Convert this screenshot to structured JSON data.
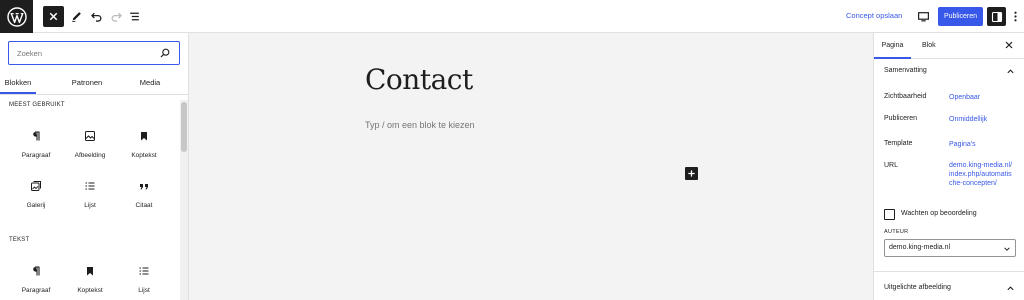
{
  "toolbar": {
    "logo": "wordpress-logo",
    "icons": [
      "close-icon",
      "pencil-icon",
      "undo-icon",
      "redo-icon",
      "list-view-icon",
      "desktop-icon",
      "sidebar-icon",
      "more-vertical-icon"
    ],
    "save_draft_label": "Concept opslaan",
    "publish_label": "Publiceren"
  },
  "inserter": {
    "search_placeholder": "Zoeken",
    "tabs": [
      {
        "label": "Blokken",
        "active": true
      },
      {
        "label": "Patronen",
        "active": false
      },
      {
        "label": "Media",
        "active": false
      }
    ],
    "categories": [
      {
        "title": "MEEST GEBRUIKT",
        "blocks": [
          {
            "label": "Paragraaf",
            "icon": "paragraph-icon"
          },
          {
            "label": "Afbeelding",
            "icon": "image-icon"
          },
          {
            "label": "Koptekst",
            "icon": "heading-bookmark-icon"
          },
          {
            "label": "Galerij",
            "icon": "gallery-icon"
          },
          {
            "label": "Lijst",
            "icon": "list-icon"
          },
          {
            "label": "Citaat",
            "icon": "quote-icon"
          }
        ]
      },
      {
        "title": "TEKST",
        "blocks": [
          {
            "label": "Paragraaf",
            "icon": "paragraph-icon"
          },
          {
            "label": "Koptekst",
            "icon": "heading-bookmark-icon"
          },
          {
            "label": "Lijst",
            "icon": "list-icon"
          }
        ]
      }
    ]
  },
  "canvas": {
    "title": "Contact",
    "placeholder": "Typ / om een blok te kiezen"
  },
  "sidebar": {
    "tabs": [
      {
        "label": "Pagina",
        "active": true
      },
      {
        "label": "Blok",
        "active": false
      }
    ],
    "summary": {
      "title": "Samenvatting",
      "rows": [
        {
          "label": "Zichtbaarheid",
          "value": "Openbaar"
        },
        {
          "label": "Publiceren",
          "value": "Onmiddellijk"
        },
        {
          "label": "Template",
          "value": "Pagina's"
        },
        {
          "label": "URL",
          "value": "demo.king-media.nl/index.php/automatische-concepten/"
        }
      ],
      "pending_review_label": "Wachten op beoordeling",
      "pending_review_checked": false,
      "author_label": "AUTEUR",
      "author_value": "demo.king-media.nl"
    },
    "featured_image_title": "Uitgelichte afbeelding"
  },
  "colors": {
    "accent": "#3858e9",
    "dark": "#1e1e1e",
    "canvas_bg": "#f3f3f3",
    "border": "#e0e0e0"
  }
}
